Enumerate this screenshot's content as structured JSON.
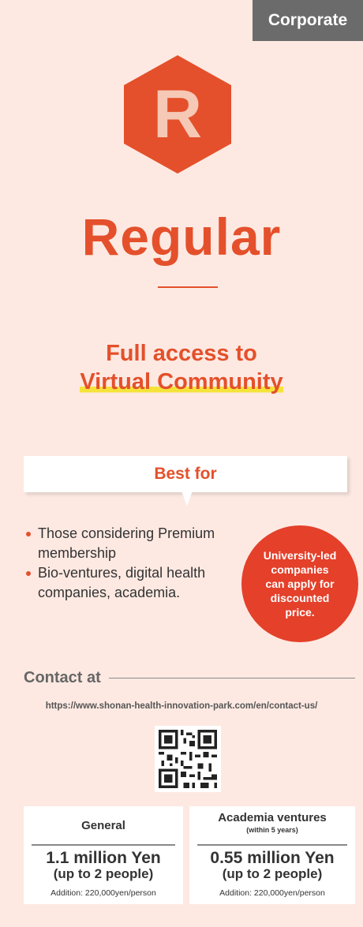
{
  "tag": "Corporate",
  "logo_letter": "R",
  "title": "Regular",
  "subtitle_line1": "Full access to",
  "subtitle_line2": "Virtual Community",
  "best_for": "Best for",
  "bullets": [
    "Those considering Premium membership",
    "Bio-ventures, digital health companies, academia."
  ],
  "badge": "University-led companies can apply for discounted price.",
  "contact_label": "Contact at",
  "contact_url": "https://www.shonan-health-innovation-park.com/en/contact-us/",
  "prices": [
    {
      "heading": "General",
      "subheading": "",
      "amount": "1.1 million Yen",
      "people": "(up to 2 people)",
      "addition": "Addition: 220,000yen/person"
    },
    {
      "heading": "Academia ventures",
      "subheading": "(within 5 years)",
      "amount": "0.55 million Yen",
      "people": "(up to 2 people)",
      "addition": "Addition: 220,000yen/person"
    }
  ],
  "colors": {
    "accent": "#e4502b",
    "background": "#fde9e2",
    "tag_bg": "#6b6b6b",
    "highlight": "#f6e33a"
  },
  "icons": {
    "logo": "hexagon-r-logo-icon",
    "qr": "qr-code-icon"
  }
}
